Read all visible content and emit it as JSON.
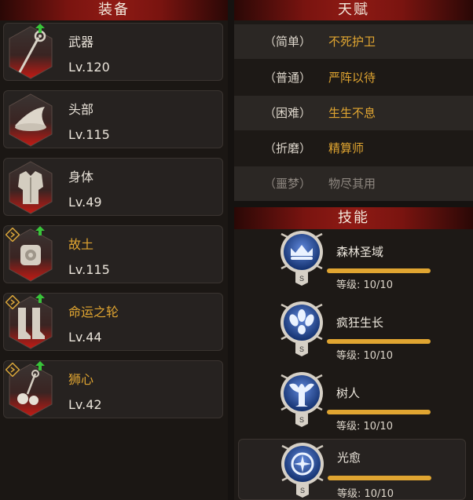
{
  "equipment": {
    "title": "装备",
    "items": [
      {
        "name": "武器",
        "level": "Lv.120",
        "icon": "staff-icon",
        "badge": "arrow-up",
        "gold": false
      },
      {
        "name": "头部",
        "level": "Lv.115",
        "icon": "hat-icon",
        "badge": "",
        "gold": false
      },
      {
        "name": "身体",
        "level": "Lv.49",
        "icon": "armor-icon",
        "badge": "",
        "gold": false
      },
      {
        "name": "故土",
        "level": "Lv.115",
        "icon": "relic-icon",
        "badge": "arrow-up",
        "gold": true
      },
      {
        "name": "命运之轮",
        "level": "Lv.44",
        "icon": "boots-icon",
        "badge": "arrow-up",
        "gold": true
      },
      {
        "name": "狮心",
        "level": "Lv.42",
        "icon": "charm-icon",
        "badge": "arrow-up",
        "gold": true
      }
    ]
  },
  "talents": {
    "title": "天赋",
    "rows": [
      {
        "difficulty": "（简单）",
        "name": "不死护卫",
        "dim": false
      },
      {
        "difficulty": "（普通）",
        "name": "严阵以待",
        "dim": false
      },
      {
        "difficulty": "（困难）",
        "name": "生生不息",
        "dim": false
      },
      {
        "difficulty": "（折磨）",
        "name": "精算师",
        "dim": false
      },
      {
        "difficulty": "（噩梦）",
        "name": "物尽其用",
        "dim": true
      }
    ]
  },
  "skills": {
    "title": "技能",
    "rank_label": "S",
    "items": [
      {
        "name": "森林圣域",
        "level": "等级: 10/10",
        "progress": 1.0,
        "icon": "crown-icon"
      },
      {
        "name": "疯狂生长",
        "level": "等级: 10/10",
        "progress": 1.0,
        "icon": "seeds-icon"
      },
      {
        "name": "树人",
        "level": "等级: 10/10",
        "progress": 1.0,
        "icon": "tree-icon"
      },
      {
        "name": "光愈",
        "level": "等级: 10/10",
        "progress": 1.0,
        "icon": "sun-icon"
      }
    ]
  },
  "colors": {
    "accent_gold": "#e0a531",
    "header_red": "#8e1a14",
    "upgrade_green": "#39c43a"
  }
}
